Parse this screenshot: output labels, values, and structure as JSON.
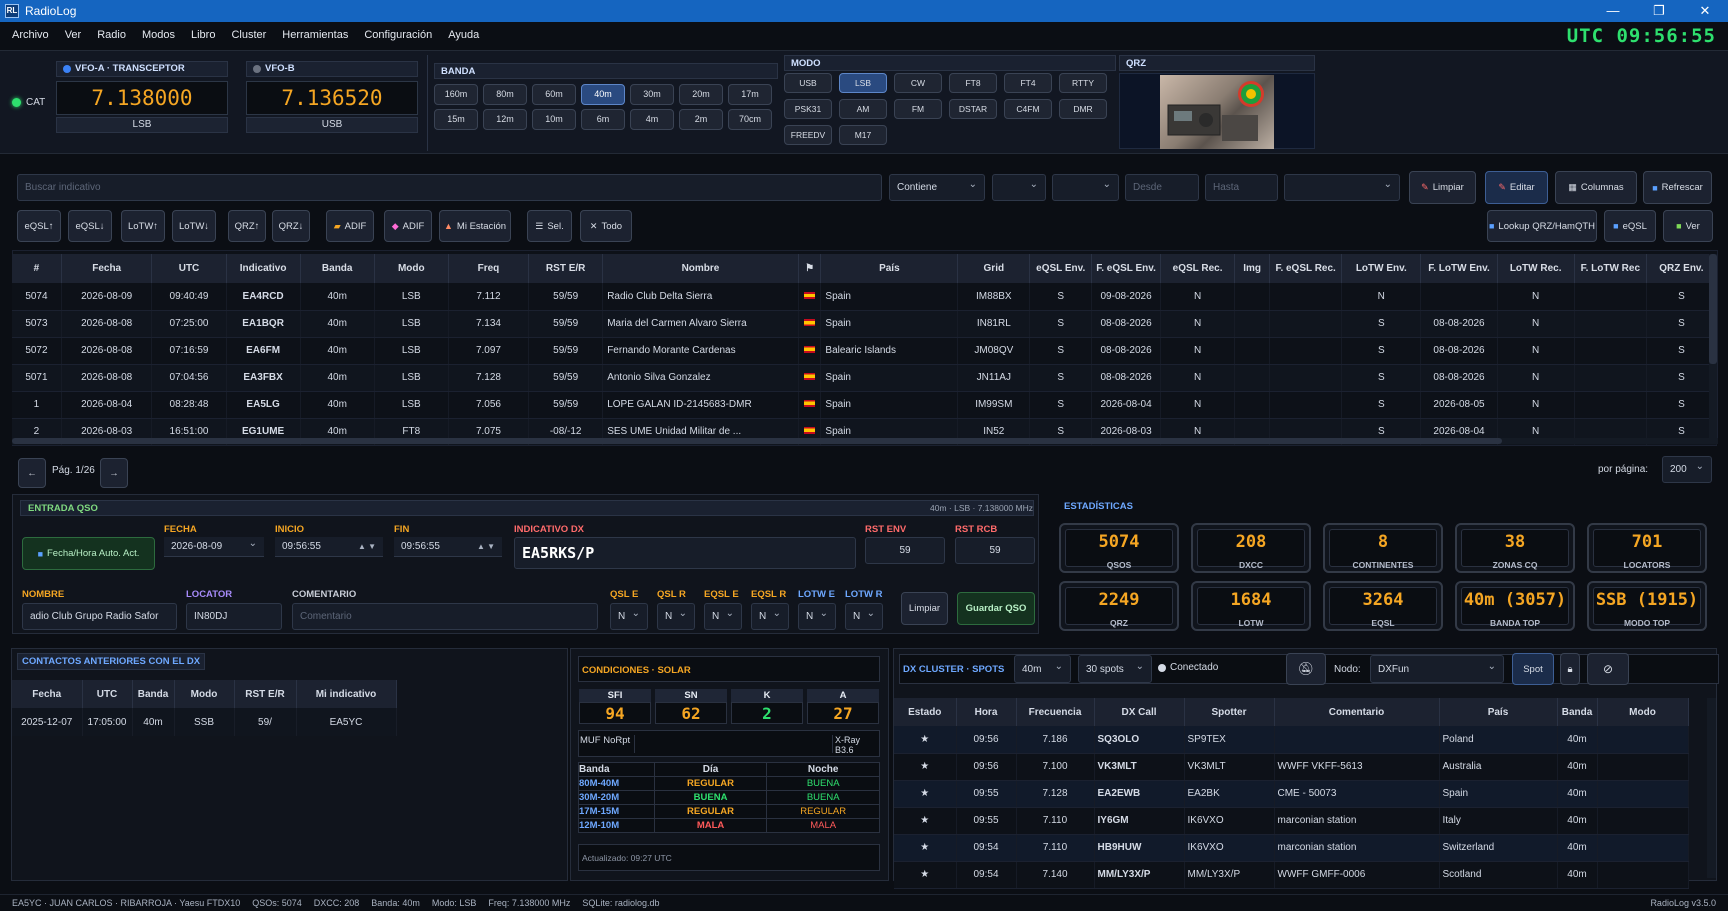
{
  "app": {
    "title": "RadioLog",
    "icon": "RL"
  },
  "window_controls": {
    "minimize": "—",
    "maximize": "❐",
    "close": "✕"
  },
  "menu": [
    "Archivo",
    "Ver",
    "Radio",
    "Modos",
    "Libro",
    "Cluster",
    "Herramientas",
    "Configuración",
    "Ayuda"
  ],
  "utc_clock": "UTC 09:56:55",
  "cat": {
    "label": "CAT",
    "status_color": "#2ee06e"
  },
  "vfo_a": {
    "title": "VFO-A · TRANSCEPTOR",
    "freq": "7.138000",
    "mode": "LSB"
  },
  "vfo_b": {
    "title": "VFO-B",
    "freq": "7.136520",
    "mode": "USB"
  },
  "banda": {
    "title": "BANDA",
    "bands": [
      "160m",
      "80m",
      "60m",
      "40m",
      "30m",
      "20m",
      "17m",
      "15m",
      "12m",
      "10m",
      "6m",
      "4m",
      "2m",
      "70cm"
    ],
    "selected": "40m"
  },
  "modo": {
    "title": "MODO",
    "modes": [
      "USB",
      "LSB",
      "CW",
      "FT8",
      "FT4",
      "RTTY",
      "PSK31",
      "AM",
      "FM",
      "DSTAR",
      "C4FM",
      "DMR",
      "FREEDV",
      "M17"
    ],
    "selected": "LSB"
  },
  "qrz": {
    "title": "QRZ"
  },
  "search": {
    "placeholder": "Buscar indicativo",
    "match": "Contiene",
    "desde": "Desde",
    "hasta": "Hasta"
  },
  "toolbar1": {
    "limpiar": "Limpiar",
    "editar": "Editar",
    "columnas": "Columnas",
    "refrescar": "Refrescar"
  },
  "toolbar2": {
    "buttons": [
      "eQSL↑",
      "eQSL↓",
      "LoTW↑",
      "LoTW↓",
      "QRZ↑",
      "QRZ↓"
    ],
    "adif_import": "ADIF",
    "adif_export": "ADIF",
    "mi_estacion": "Mi Estación",
    "sel": "Sel.",
    "todo": "Todo",
    "lookup": "Lookup QRZ/HamQTH",
    "eqsl": "eQSL",
    "ver": "Ver"
  },
  "log": {
    "columns": [
      "#",
      "Fecha",
      "UTC",
      "Indicativo",
      "Banda",
      "Modo",
      "Freq",
      "RST E/R",
      "Nombre",
      "⚑",
      "País",
      "Grid",
      "eQSL Env.",
      "F. eQSL Env.",
      "eQSL Rec.",
      "Img",
      "F. eQSL Rec.",
      "LoTW Env.",
      "F. LoTW Env.",
      "LoTW Rec.",
      "F. LoTW Rec",
      "QRZ Env."
    ],
    "rows": [
      [
        "5074",
        "2026-08-09",
        "09:40:49",
        "EA4RCD",
        "40m",
        "LSB",
        "7.112",
        "59/59",
        "Radio Club Delta Sierra",
        "Spain",
        "IM88BX",
        "S",
        "09-08-2026",
        "N",
        "",
        "",
        "N",
        "",
        "N",
        "",
        "S"
      ],
      [
        "5073",
        "2026-08-08",
        "07:25:00",
        "EA1BQR",
        "40m",
        "LSB",
        "7.134",
        "59/59",
        "Maria del Carmen Alvaro Sierra",
        "Spain",
        "IN81RL",
        "S",
        "08-08-2026",
        "N",
        "",
        "",
        "S",
        "08-08-2026",
        "N",
        "",
        "S"
      ],
      [
        "5072",
        "2026-08-08",
        "07:16:59",
        "EA6FM",
        "40m",
        "LSB",
        "7.097",
        "59/59",
        "Fernando Morante Cardenas",
        "Balearic Islands",
        "JM08QV",
        "S",
        "08-08-2026",
        "N",
        "",
        "",
        "S",
        "08-08-2026",
        "N",
        "",
        "S"
      ],
      [
        "5071",
        "2026-08-08",
        "07:04:56",
        "EA3FBX",
        "40m",
        "LSB",
        "7.128",
        "59/59",
        "Antonio Silva Gonzalez",
        "Spain",
        "JN11AJ",
        "S",
        "08-08-2026",
        "N",
        "",
        "",
        "S",
        "08-08-2026",
        "N",
        "",
        "S"
      ],
      [
        "1",
        "2026-08-04",
        "08:28:48",
        "EA5LG",
        "40m",
        "LSB",
        "7.056",
        "59/59",
        "LOPE GALAN ID-2145683-DMR",
        "Spain",
        "IM99SM",
        "S",
        "2026-08-04",
        "N",
        "",
        "",
        "S",
        "2026-08-05",
        "N",
        "",
        "S"
      ],
      [
        "2",
        "2026-08-03",
        "16:51:00",
        "EG1UME",
        "40m",
        "FT8",
        "7.075",
        "-08/-12",
        "SES UME Unidad Militar de ...",
        "Spain",
        "IN52",
        "S",
        "2026-08-03",
        "N",
        "",
        "",
        "S",
        "2026-08-04",
        "N",
        "",
        "S"
      ]
    ]
  },
  "pager": {
    "prev": "←",
    "label": "Pág. 1/26",
    "next": "→",
    "per_page_label": "por página:",
    "per_page": "200"
  },
  "entry": {
    "title": "ENTRADA QSO",
    "info": "40m · LSB · 7.138000 MHz",
    "auto_btn": "Fecha/Hora Auto. Act.",
    "fecha_label": "FECHA",
    "fecha": "2026-08-09",
    "inicio_label": "INICIO",
    "inicio": "09:56:55",
    "fin_label": "FIN",
    "fin": "09:56:55",
    "call_label": "INDICATIVO DX",
    "call": "EA5RKS/P",
    "rst_env_label": "RST ENV",
    "rst_env": "59",
    "rst_rcb_label": "RST RCB",
    "rst_rcb": "59",
    "nombre_label": "NOMBRE",
    "nombre": "adio Club Grupo Radio Safor",
    "locator_label": "LOCATOR",
    "locator": "IN80DJ",
    "comentario_label": "COMENTARIO",
    "comentario_ph": "Comentario",
    "qsl": [
      {
        "label": "QSL E",
        "val": "N"
      },
      {
        "label": "QSL R",
        "val": "N"
      },
      {
        "label": "EQSL E",
        "val": "N"
      },
      {
        "label": "EQSL R",
        "val": "N"
      },
      {
        "label": "LOTW E",
        "val": "N"
      },
      {
        "label": "LOTW R",
        "val": "N"
      }
    ],
    "limpiar": "Limpiar",
    "guardar": "Guardar QSO"
  },
  "stats": {
    "title": "ESTADÍSTICAS",
    "items": [
      {
        "v": "5074",
        "k": "QSOS"
      },
      {
        "v": "208",
        "k": "DXCC"
      },
      {
        "v": "8",
        "k": "CONTINENTES"
      },
      {
        "v": "38",
        "k": "ZONAS CQ"
      },
      {
        "v": "701",
        "k": "LOCATORS"
      },
      {
        "v": "2249",
        "k": "QRZ"
      },
      {
        "v": "1684",
        "k": "LOTW"
      },
      {
        "v": "3264",
        "k": "EQSL"
      },
      {
        "v": "40m (3057)",
        "k": "BANDA TOP"
      },
      {
        "v": "SSB (1915)",
        "k": "MODO TOP"
      }
    ]
  },
  "prev": {
    "title": "CONTACTOS ANTERIORES CON EL DX",
    "columns": [
      "Fecha",
      "UTC",
      "Banda",
      "Modo",
      "RST E/R",
      "Mi indicativo"
    ],
    "rows": [
      [
        "2025-12-07",
        "17:05:00",
        "40m",
        "SSB",
        "59/",
        "EA5YC"
      ]
    ]
  },
  "solar": {
    "title": "CONDICIONES · SOLAR",
    "heads": [
      "SFI",
      "SN",
      "K",
      "A"
    ],
    "vals": [
      "94",
      "62",
      "2",
      "27"
    ],
    "muf": "MUF NoRpt",
    "xray": "X-Ray B3.6",
    "table_heads": [
      "Banda",
      "Día",
      "Noche"
    ],
    "rows": [
      [
        "80M-40M",
        "REGULAR",
        "BUENA"
      ],
      [
        "30M-20M",
        "BUENA",
        "BUENA"
      ],
      [
        "17M-15M",
        "REGULAR",
        "REGULAR"
      ],
      [
        "12M-10M",
        "MALA",
        "MALA"
      ]
    ],
    "updated": "Actualizado: 09:27 UTC",
    "colors": {
      "REGULAR": "#f5a623",
      "BUENA": "#2ee06e",
      "MALA": "#ff5a5a"
    }
  },
  "cluster": {
    "title": "DX CLUSTER · SPOTS",
    "band": "40m",
    "spots": "30 spots",
    "status": "Conectado",
    "nodo_label": "Nodo:",
    "nodo": "DXFun",
    "spot_btn": "Spot",
    "columns": [
      "Estado",
      "Hora",
      "Frecuencia",
      "DX Call",
      "Spotter",
      "Comentario",
      "País",
      "Banda",
      "Modo"
    ],
    "rows": [
      [
        "★",
        "09:56",
        "7.186",
        "SQ3OLO",
        "SP9TEX",
        "",
        "Poland",
        "40m",
        ""
      ],
      [
        "★",
        "09:56",
        "7.100",
        "VK3MLT",
        "VK3MLT",
        "WWFF VKFF-5613",
        "Australia",
        "40m",
        ""
      ],
      [
        "★",
        "09:55",
        "7.128",
        "EA2EWB",
        "EA2BK",
        "CME - 50073",
        "Spain",
        "40m",
        ""
      ],
      [
        "★",
        "09:55",
        "7.110",
        "IY6GM",
        "IK6VXO",
        "marconian station",
        "Italy",
        "40m",
        ""
      ],
      [
        "★",
        "09:54",
        "7.110",
        "HB9HUW",
        "IK6VXO",
        "marconian station",
        "Switzerland",
        "40m",
        ""
      ],
      [
        "★",
        "09:54",
        "7.140",
        "MM/LY3X/P",
        "MM/LY3X/P",
        "WWFF GMFF-0006",
        "Scotland",
        "40m",
        ""
      ]
    ]
  },
  "status": {
    "station": "EA5YC · JUAN CARLOS · RIBARROJA · Yaesu FTDX10",
    "qsos": "QSOs: 5074",
    "dxcc": "DXCC: 208",
    "banda": "Banda: 40m",
    "modo": "Modo: LSB",
    "freq": "Freq: 7.138000 MHz",
    "db": "SQLite: radiolog.db",
    "version": "RadioLog v3.5.0"
  }
}
